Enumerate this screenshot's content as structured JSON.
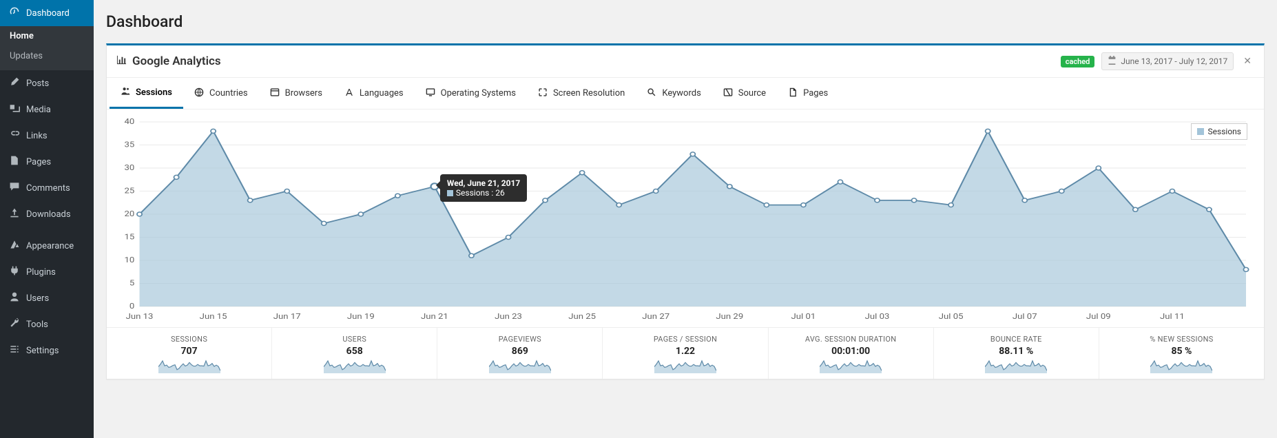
{
  "sidebar": {
    "menu": [
      {
        "id": "dashboard",
        "label": "Dashboard",
        "active": true,
        "sub": [
          {
            "id": "home",
            "label": "Home",
            "current": true
          },
          {
            "id": "updates",
            "label": "Updates",
            "current": false
          }
        ]
      },
      {
        "id": "posts",
        "label": "Posts"
      },
      {
        "id": "media",
        "label": "Media"
      },
      {
        "id": "links",
        "label": "Links"
      },
      {
        "id": "pages_m",
        "label": "Pages"
      },
      {
        "id": "comments",
        "label": "Comments"
      },
      {
        "id": "downloads",
        "label": "Downloads"
      },
      {
        "__sep": true
      },
      {
        "id": "appearance",
        "label": "Appearance"
      },
      {
        "id": "plugins",
        "label": "Plugins"
      },
      {
        "id": "users",
        "label": "Users"
      },
      {
        "id": "tools",
        "label": "Tools"
      },
      {
        "id": "settings",
        "label": "Settings"
      }
    ]
  },
  "page": {
    "title": "Dashboard"
  },
  "panel": {
    "title": "Google Analytics",
    "cached_label": "cached",
    "date_range": "June 13, 2017 - July 12, 2017"
  },
  "tabs": [
    {
      "id": "sessions",
      "label": "Sessions",
      "active": true
    },
    {
      "id": "countries",
      "label": "Countries"
    },
    {
      "id": "browsers",
      "label": "Browsers"
    },
    {
      "id": "languages",
      "label": "Languages"
    },
    {
      "id": "os",
      "label": "Operating Systems"
    },
    {
      "id": "screen",
      "label": "Screen Resolution"
    },
    {
      "id": "keywords",
      "label": "Keywords"
    },
    {
      "id": "source",
      "label": "Source"
    },
    {
      "id": "pages_t",
      "label": "Pages"
    }
  ],
  "chart_data": {
    "type": "area",
    "title": "",
    "xlabel": "",
    "ylabel": "",
    "ylim": [
      0,
      40
    ],
    "yticks": [
      0,
      5,
      10,
      15,
      20,
      25,
      30,
      35,
      40
    ],
    "xtick_labels": [
      "Jun 13",
      "Jun 15",
      "Jun 17",
      "Jun 19",
      "Jun 21",
      "Jun 23",
      "Jun 25",
      "Jun 27",
      "Jun 29",
      "Jul 01",
      "Jul 03",
      "Jul 05",
      "Jul 07",
      "Jul 09",
      "Jul 11"
    ],
    "legend": "Sessions",
    "series": [
      {
        "name": "Sessions",
        "values": [
          20,
          28,
          38,
          23,
          25,
          18,
          20,
          24,
          26,
          11,
          15,
          23,
          29,
          22,
          25,
          33,
          26,
          22,
          22,
          27,
          23,
          23,
          22,
          38,
          23,
          25,
          30,
          21,
          25,
          21,
          8
        ]
      }
    ],
    "tooltip": {
      "date": "Wed, June 21, 2017",
      "series": "Sessions",
      "value": 26,
      "at_index": 8
    }
  },
  "summary": [
    {
      "label": "SESSIONS",
      "value": "707"
    },
    {
      "label": "USERS",
      "value": "658"
    },
    {
      "label": "PAGEVIEWS",
      "value": "869"
    },
    {
      "label": "PAGES / SESSION",
      "value": "1.22"
    },
    {
      "label": "AVG. SESSION DURATION",
      "value": "00:01:00"
    },
    {
      "label": "BOUNCE RATE",
      "value": "88.11 %"
    },
    {
      "label": "% NEW SESSIONS",
      "value": "85 %"
    }
  ]
}
